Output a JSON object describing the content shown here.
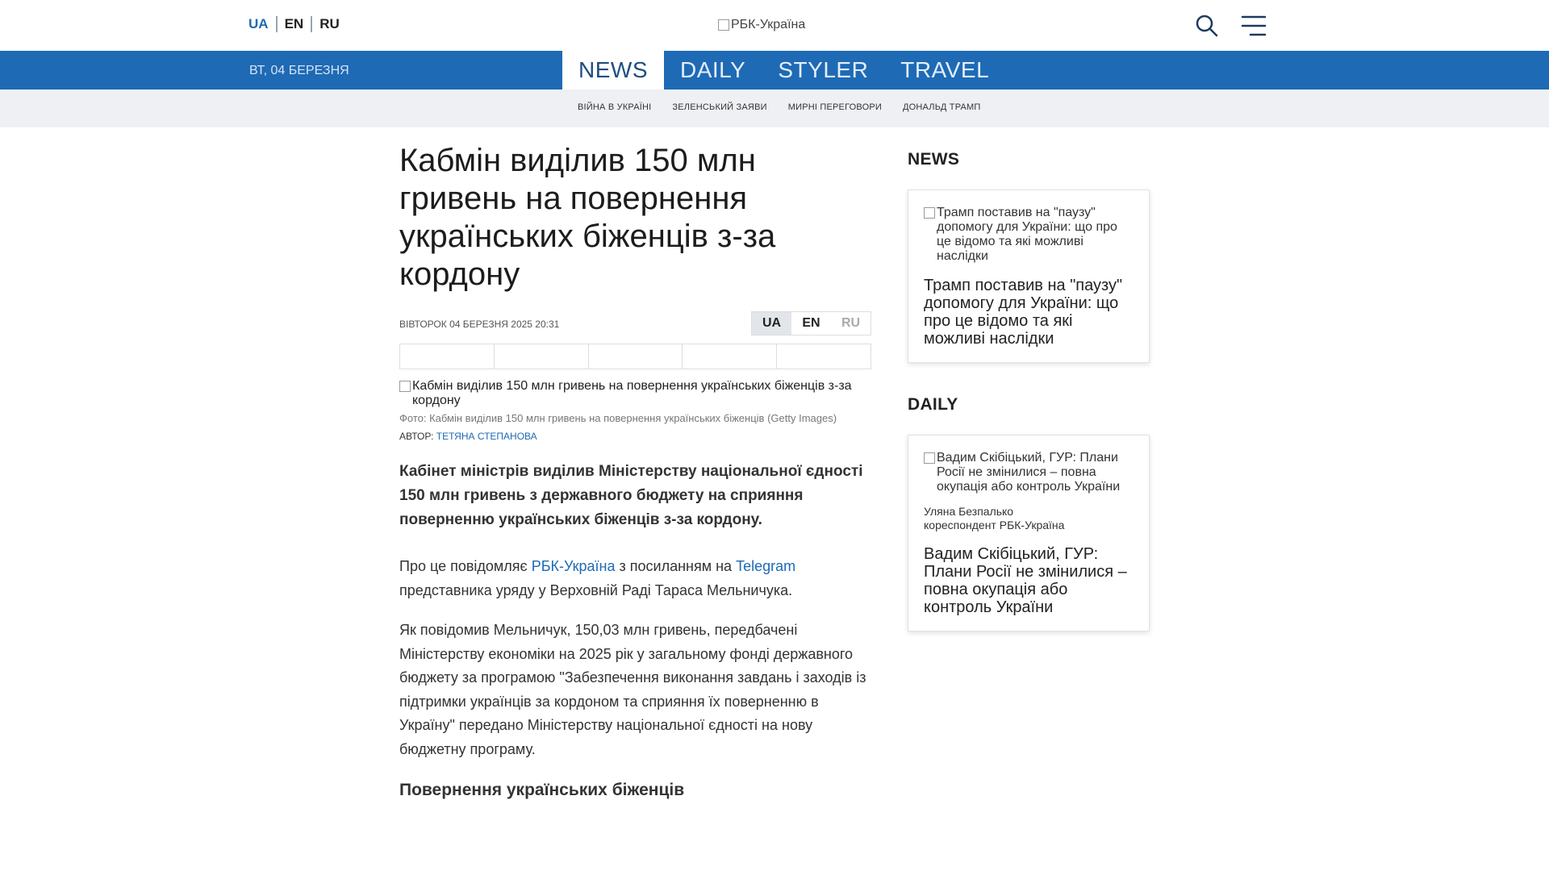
{
  "header": {
    "languages": [
      "UA",
      "EN",
      "RU"
    ],
    "logo_alt": "РБК-Україна",
    "search_icon": "search-icon",
    "menu_icon": "hamburger-menu-icon"
  },
  "nav": {
    "date": "ВТ, 04 БЕРЕЗНЯ",
    "sections": [
      "NEWS",
      "DAILY",
      "STYLER",
      "TRAVEL"
    ],
    "active_section": "NEWS"
  },
  "tags": [
    "ВІЙНА В УКРАЇНІ",
    "ЗЕЛЕНСЬКИЙ ЗАЯВИ",
    "МИРНІ ПЕРЕГОВОРИ",
    "ДОНАЛЬД ТРАМП"
  ],
  "article": {
    "title": "Кабмін виділив 150 млн гривень на повернення українських біженців з-за кордону",
    "published": "ВІВТОРОК 04 БЕРЕЗНЯ 2025 20:31",
    "languages": [
      "UA",
      "EN",
      "RU"
    ],
    "image_alt": "Кабмін виділив 150 млн гривень на повернення українських біженців з-за кордону",
    "caption": "Фото: Кабмін виділив 150 млн гривень на повернення українських біженців (Getty Images)",
    "author_label": "АВТОР:",
    "author_name": "ТЕТЯНА СТЕПАНОВА",
    "lead": "Кабінет міністрів виділив Міністерству національної єдності 150 млн гривень з державного бюджету на сприяння поверненню українських біженців з-за кордону.",
    "p1": {
      "t1": "Про це повідомляє ",
      "link1": "РБК-Україна",
      "t2": " з посиланням на ",
      "link2": "Telegram",
      "t3": " представника уряду у Верховній Раді Тараса Мельничука."
    },
    "p2": "Як повідомив Мельничук, 150,03 млн гривень, передбачені Міністерству економіки на 2025 рік у загальному фонді державного бюджету за програмою \"Забезпечення виконання завдань і заходів із підтримки українців за кордоном та сприяння їх поверненню в Україну\" передано Міністерству національної єдності на нову бюджетну програму.",
    "subheading": "Повернення українських біженців"
  },
  "sidebar": {
    "news": {
      "title": "NEWS",
      "image_alt": "Трамп поставив на \"паузу\" допомогу для України: що про це відомо та які можливі наслідки",
      "headline": "Трамп поставив на \"паузу\" допомогу для України: що про це відомо та які можливі наслідки"
    },
    "daily": {
      "title": "DAILY",
      "image_alt": "Вадим Скібіцький, ГУР: Плани Росії не змінилися – повна окупація або контроль України",
      "author_name": "Уляна Безпалько",
      "author_role": "кореспондент РБК-Україна",
      "headline": "Вадим Скібіцький, ГУР: Плани Росії не змінилися – повна окупація або контроль України"
    }
  },
  "colors": {
    "brand_blue": "#1e6ab5",
    "tags_bg": "#eef0f3"
  }
}
